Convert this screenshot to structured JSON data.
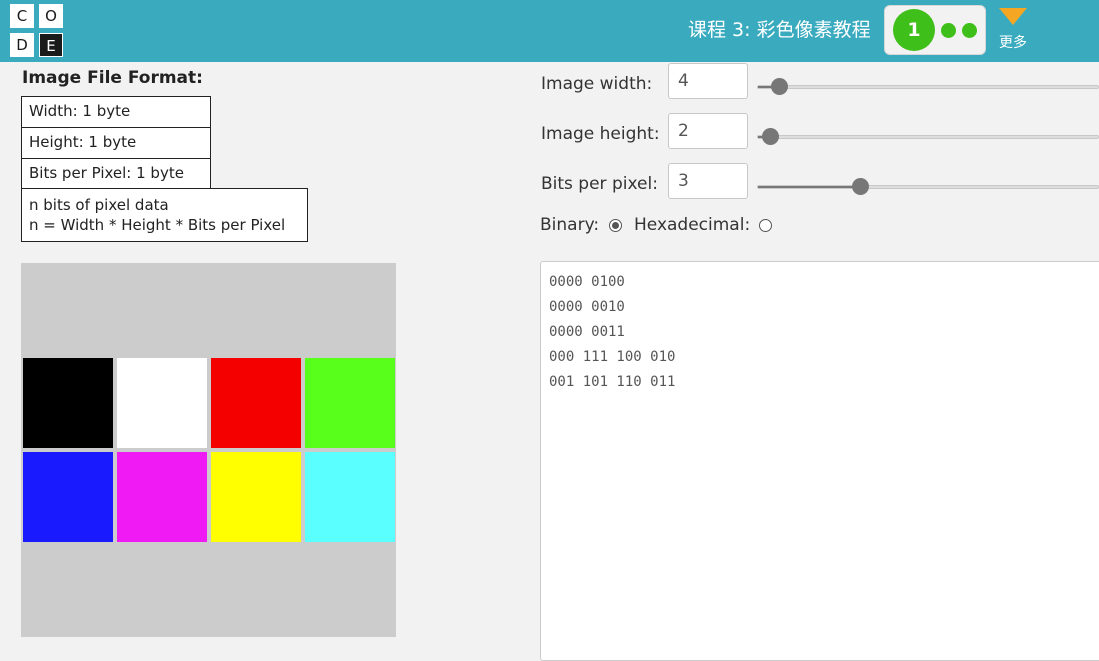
{
  "header": {
    "logo_letters": [
      "C",
      "O",
      "D",
      "E"
    ],
    "lesson_title": "课程 3: 彩色像素教程",
    "progress": {
      "current": "1",
      "dots": 2,
      "color": "#3fbf1a"
    },
    "more_label": "更多",
    "background": "#3aabbf"
  },
  "format": {
    "title": "Image File Format:",
    "rows": [
      "Width: 1 byte",
      "Height: 1 byte",
      "Bits per Pixel: 1 byte"
    ],
    "data_line1": "n bits of pixel data",
    "data_line2": "n = Width * Height * Bits per Pixel"
  },
  "canvas": {
    "pixels": [
      "#000000",
      "#ffffff",
      "#f50000",
      "#58ff1a",
      "#1a1aff",
      "#f01af5",
      "#ffff00",
      "#5affff"
    ]
  },
  "controls": {
    "width": {
      "label": "Image width:",
      "value": "4"
    },
    "height": {
      "label": "Image height:",
      "value": "2"
    },
    "bpp": {
      "label": "Bits per pixel:",
      "value": "3"
    },
    "binary_label": "Binary:",
    "hex_label": "Hexadecimal:",
    "mode": "binary"
  },
  "output": {
    "lines": [
      "0000 0100",
      "0000 0010",
      "0000 0011",
      "000 111 100 010",
      "001 101 110 011"
    ]
  }
}
